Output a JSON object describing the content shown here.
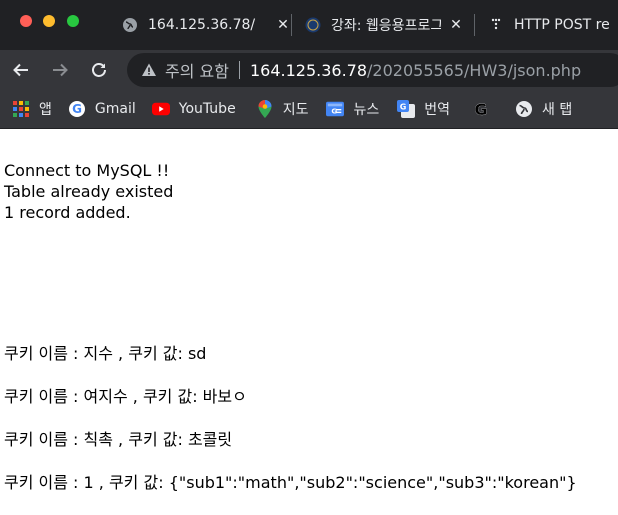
{
  "browser": {
    "tabs": [
      {
        "title": "164.125.36.78/",
        "icon": "globe-icon"
      },
      {
        "title": "강좌: 웹응용프로그",
        "icon": "university-icon"
      },
      {
        "title": "HTTP POST re",
        "icon": "dots-icon"
      }
    ],
    "close_glyph": "✕",
    "address_bar": {
      "warning_label": "주의 요함",
      "url_host": "164.125.36.78",
      "url_path": "/202055565/HW3/json.php"
    },
    "bookmarks": [
      {
        "label": "앱",
        "icon": "apps-grid-icon"
      },
      {
        "label": "Gmail",
        "icon": "google-icon"
      },
      {
        "label": "YouTube",
        "icon": "youtube-icon"
      },
      {
        "label": "지도",
        "icon": "maps-pin-icon"
      },
      {
        "label": "뉴스",
        "icon": "news-icon"
      },
      {
        "label": "번역",
        "icon": "translate-icon"
      },
      {
        "label": "",
        "icon": "g-logo-icon"
      },
      {
        "label": "새 탭",
        "icon": "globe-icon"
      }
    ]
  },
  "page": {
    "status_lines": [
      "Connect to MySQL !!",
      "Table already existed",
      "1 record added."
    ],
    "cookies": [
      "쿠키 이름 : 지수 , 쿠키 값: sd",
      "쿠키 이름 : 여지수 , 쿠키 값: 바보ㅇ",
      "쿠키 이름 : 칙촉 , 쿠키 값: 초콜릿",
      "쿠키 이름 : 1 , 쿠키 값: {\"sub1\":\"math\",\"sub2\":\"science\",\"sub3\":\"korean\"}"
    ]
  }
}
